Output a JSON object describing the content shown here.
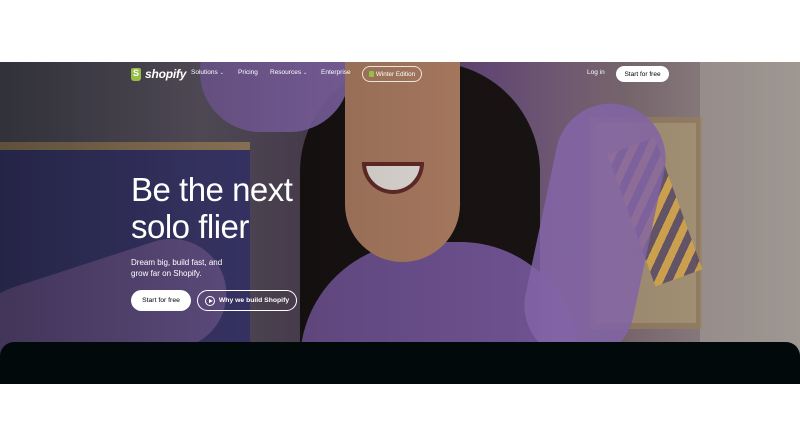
{
  "nav": {
    "logo_text": "shopify",
    "items": [
      {
        "label": "Solutions",
        "dropdown": true
      },
      {
        "label": "Pricing",
        "dropdown": false
      },
      {
        "label": "Resources",
        "dropdown": true
      },
      {
        "label": "Enterprise",
        "dropdown": false
      }
    ],
    "edition_label": "Winter Edition",
    "login_label": "Log in",
    "cta_label": "Start for free"
  },
  "hero": {
    "headline_line1": "Be the next",
    "headline_line2": "solo flier",
    "subtext": "Dream big, build fast, and grow far on Shopify.",
    "primary_button": "Start for free",
    "secondary_button": "Why we build Shopify"
  },
  "icons": {
    "logo": "shopify-bag-icon",
    "edition": "shopify-bag-icon",
    "dropdown": "chevron-down-icon",
    "play": "play-circle-icon"
  },
  "colors": {
    "brand_green": "#95bf47",
    "dark_band": "#02090a"
  }
}
